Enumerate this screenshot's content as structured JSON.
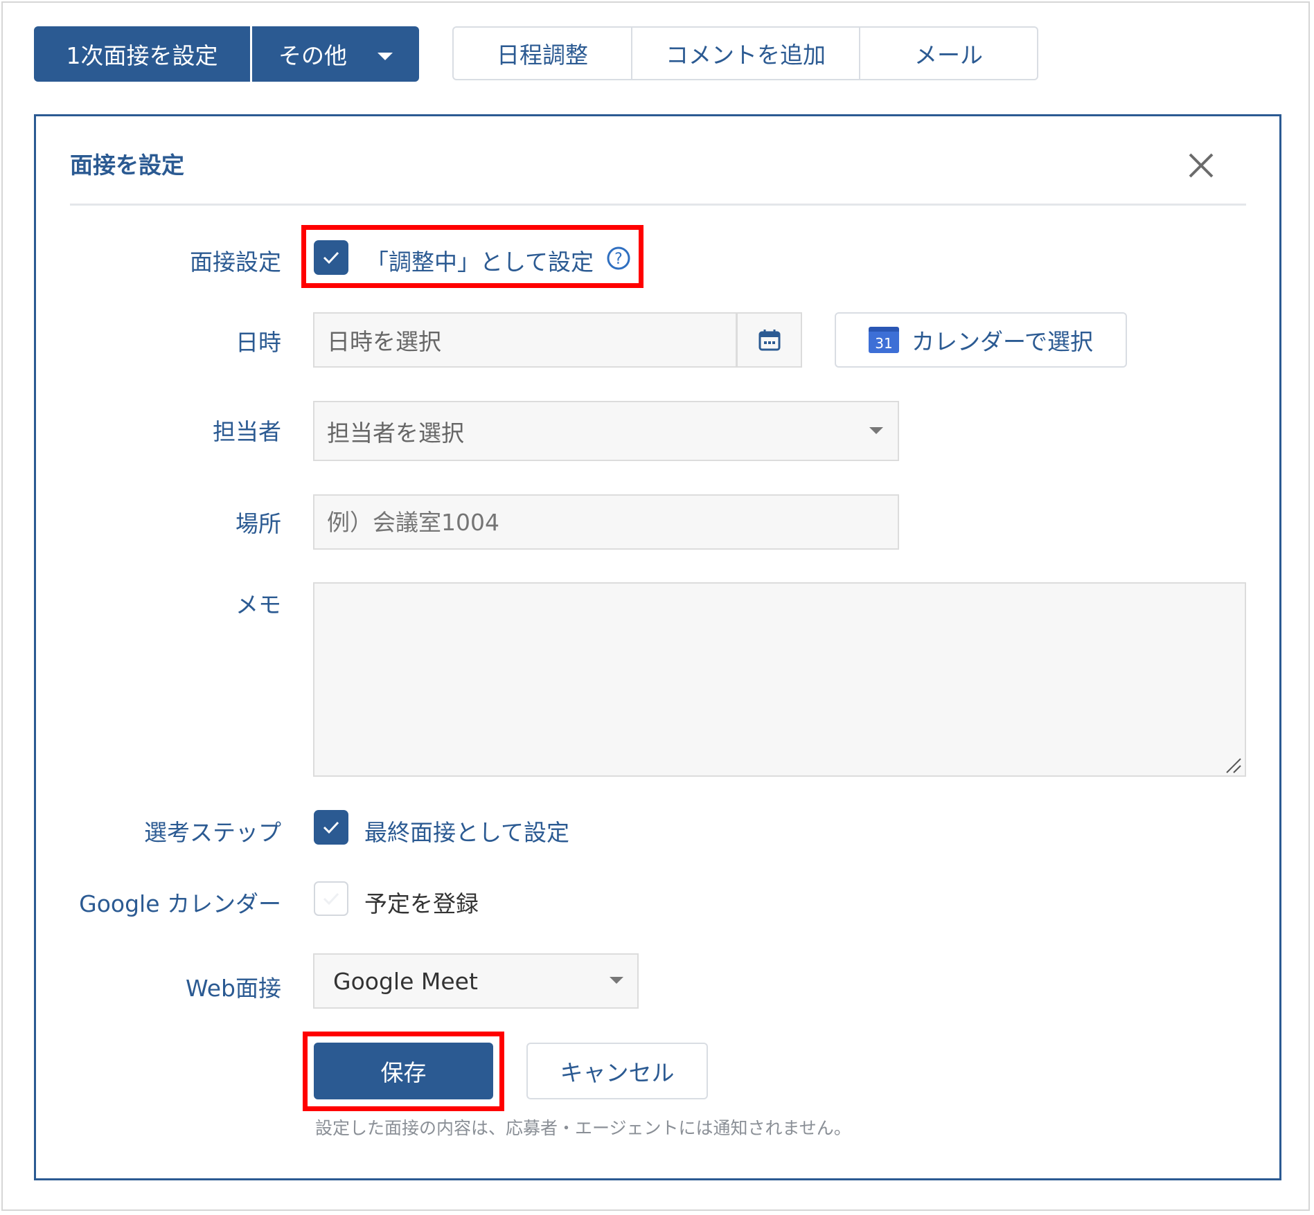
{
  "toolbar": {
    "primary_button": "1次面接を設定",
    "other_button": "その他",
    "schedule_button": "日程調整",
    "comment_button": "コメントを追加",
    "mail_button": "メール"
  },
  "panel": {
    "title": "面接を設定",
    "interview_setting": {
      "label": "面接設定",
      "checkbox_text": "「調整中」として設定",
      "checked": true
    },
    "datetime": {
      "label": "日時",
      "placeholder": "日時を選択",
      "calendar_button": "カレンダーで選択",
      "calendar_icon_text": "31"
    },
    "person_in_charge": {
      "label": "担当者",
      "placeholder": "担当者を選択"
    },
    "location": {
      "label": "場所",
      "placeholder": "例）会議室1004"
    },
    "memo": {
      "label": "メモ",
      "value": ""
    },
    "selection_step": {
      "label": "選考ステップ",
      "checkbox_text": "最終面接として設定",
      "checked": true
    },
    "google_calendar": {
      "label": "Google カレンダー",
      "checkbox_text": "予定を登録",
      "checked": false
    },
    "web_interview": {
      "label": "Web面接",
      "selected": "Google Meet"
    },
    "save_button": "保存",
    "cancel_button": "キャンセル",
    "note": "設定した面接の内容は、応募者・エージェントには通知されません。"
  },
  "colors": {
    "primary": "#2b5a92",
    "highlight": "#ff0000"
  }
}
